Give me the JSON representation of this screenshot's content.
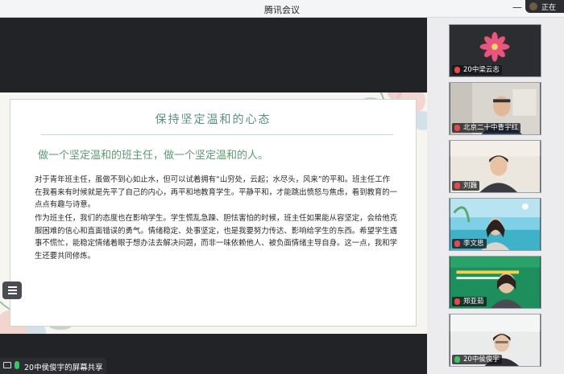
{
  "window": {
    "title": "腾讯会议",
    "minimize_glyph": "—"
  },
  "speaking_indicator": {
    "label": "正在"
  },
  "slide": {
    "title": "保持坚定温和的心态",
    "subtitle": "做一个坚定温和的班主任，做一个坚定温和的人。",
    "paragraph1": "对于青年班主任，虽做不到心如止水，但可以试着拥有“山穷处，云起；水尽头，风来”的平和。班主任工作在我看来有时候就是先平了自己的内心，再平和地教育学生。平静平和，才能跳出愤怒与焦虑，看到教育的一点点有趣与诗意。",
    "paragraph2": "作为班主任，我们的态度也在影响学生。学生慌乱急躁、胆怯害怕的时候，班主任如果能从容坚定，会给他克服困难的信心和直面错误的勇气。情绪稳定、处事坚定，也是我要努力传达、影响给学生的东西。希望学生遇事不慌忙，能稳定情绪着眼于想办法去解决问题，而非一味依赖他人、被负面情绪主导自身。这一点，我和学生还要共同修炼。"
  },
  "share_bar": {
    "label": "20中侯俊宇的屏幕共享",
    "icon": "screen-share-icon"
  },
  "participants": [
    {
      "name": "20中梁云志",
      "mic": "muted",
      "scene": "flower-avatar"
    },
    {
      "name": "北京二十中曹宇红",
      "mic": "muted",
      "scene": "office-camera"
    },
    {
      "name": "刘巍",
      "mic": "muted",
      "scene": "home-camera"
    },
    {
      "name": "李文思",
      "mic": "muted",
      "scene": "beach-background"
    },
    {
      "name": "郑亚茹",
      "mic": "muted",
      "scene": "conference-background"
    },
    {
      "name": "20中侯俊宇",
      "mic": "on",
      "scene": "home-camera"
    }
  ],
  "colors": {
    "accent_green": "#5d9a72",
    "title_teal": "#5b8f86",
    "mic_on": "#3cc36a",
    "mic_off": "#e04b4b"
  }
}
